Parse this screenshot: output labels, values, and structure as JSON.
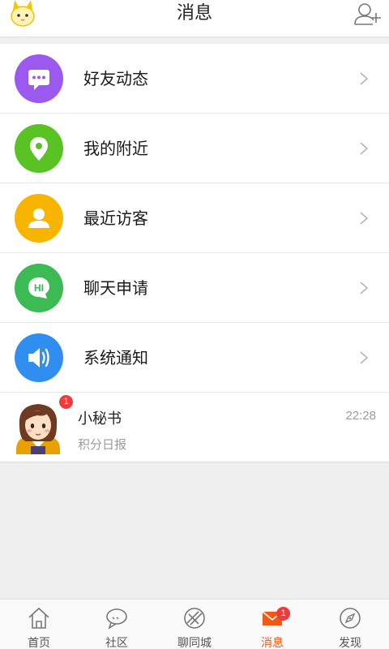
{
  "header": {
    "title": "消息",
    "avatar_icon": "cat-avatar-icon",
    "add_friend_icon": "add-friend-icon"
  },
  "menu": [
    {
      "label": "好友动态",
      "icon": "chat-bubble-icon",
      "color": "#9b59f0"
    },
    {
      "label": "我的附近",
      "icon": "location-pin-icon",
      "color": "#58c322"
    },
    {
      "label": "最近访客",
      "icon": "person-icon",
      "color": "#f7b500"
    },
    {
      "label": "聊天申请",
      "icon": "hi-bubble-icon",
      "color": "#3cba54"
    },
    {
      "label": "系统通知",
      "icon": "speaker-icon",
      "color": "#2f8ef0"
    }
  ],
  "message": {
    "name": "小秘书",
    "preview": "积分日报",
    "time": "22:28",
    "badge": "1"
  },
  "tabbar": {
    "tabs": [
      {
        "label": "首页",
        "icon": "home-icon"
      },
      {
        "label": "社区",
        "icon": "chat-icon"
      },
      {
        "label": "聊同城",
        "icon": "compass-ring-icon"
      },
      {
        "label": "消息",
        "icon": "mail-icon",
        "badge": "1",
        "active": true
      },
      {
        "label": "发现",
        "icon": "discover-icon"
      }
    ],
    "active_color": "#f05a14"
  }
}
